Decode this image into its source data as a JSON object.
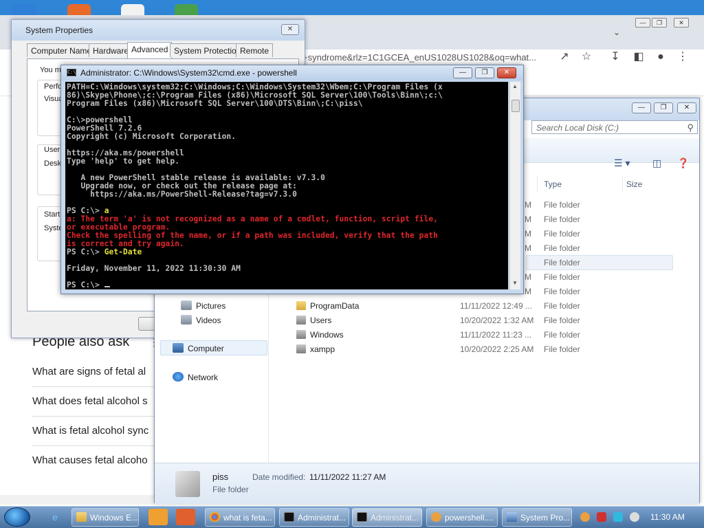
{
  "colors": {
    "console_bg": "#000000",
    "console_text": "#c0c0c0",
    "console_error": "#e0262c",
    "console_highlight": "#e6e03c",
    "taskbar": "#47719f"
  },
  "chrome": {
    "url_fragment": "+syndrome&rlz=1C1GCEA_enUS1028US1028&oq=what...",
    "people_also_ask": "People also ask",
    "questions": [
      "What are signs of fetal al",
      "What does fetal alcohol s",
      "What is fetal alcohol sync",
      "What causes fetal alcoho"
    ]
  },
  "sysprop": {
    "title": "System Properties",
    "tabs": [
      "Computer Name",
      "Hardware",
      "Advanced",
      "System Protection",
      "Remote"
    ],
    "active_tab": "Advanced",
    "fragments": [
      "You m",
      "Perfo",
      "Visua",
      "User",
      "Desk",
      "Startu",
      "Syste"
    ]
  },
  "explorer": {
    "search_placeholder": "Search Local Disk (C:)",
    "columns": [
      "Type",
      "Size"
    ],
    "nav_items": [
      "Pictures",
      "Videos",
      "Computer",
      "Network"
    ],
    "partial_rows": [
      {
        "frag": "M",
        "type": "File folder"
      },
      {
        "frag": "M",
        "type": "File folder"
      },
      {
        "frag": "M",
        "type": "File folder"
      },
      {
        "frag": "M",
        "type": "File folder"
      },
      {
        "frag": "",
        "type": "File folder"
      },
      {
        "frag": "M",
        "type": "File folder"
      },
      {
        "frag": "M",
        "type": "File folder"
      }
    ],
    "rows": [
      {
        "name": "ProgramData",
        "date": "11/11/2022 12:49 ...",
        "type": "File folder"
      },
      {
        "name": "Users",
        "date": "10/20/2022 1:32 AM",
        "type": "File folder"
      },
      {
        "name": "Windows",
        "date": "11/11/2022 11:23 ...",
        "type": "File folder"
      },
      {
        "name": "xampp",
        "date": "10/20/2022 2:25 AM",
        "type": "File folder"
      }
    ],
    "details": {
      "name": "piss",
      "label": "Date modified:",
      "date": "11/11/2022 11:27 AM",
      "type": "File folder"
    }
  },
  "cmd": {
    "title": "Administrator: C:\\Windows\\System32\\cmd.exe - powershell",
    "lines": {
      "l1": "PATH=C:\\Windows\\system32;C:\\Windows;C:\\Windows\\System32\\Wbem;C:\\Program Files (x",
      "l2": "86)\\Skype\\Phone\\;c:\\Program Files (x86)\\Microsoft SQL Server\\100\\Tools\\Binn\\;c:\\",
      "l3": "Program Files (x86)\\Microsoft SQL Server\\100\\DTS\\Binn\\;C:\\piss\\",
      "l4": "",
      "l5": "C:\\>powershell",
      "l6": "PowerShell 7.2.6",
      "l7": "Copyright (c) Microsoft Corporation.",
      "l8": "",
      "l9": "https://aka.ms/powershell",
      "l10": "Type 'help' to get help.",
      "l11": "",
      "l12": "   A new PowerShell stable release is available: v7.3.0",
      "l13": "   Upgrade now, or check out the release page at:",
      "l14": "     https://aka.ms/PowerShell-Release?tag=v7.3.0",
      "l15": "",
      "l16_prompt": "PS C:\\> ",
      "l16_cmd": "a",
      "l17": "a: The term 'a' is not recognized as a name of a cmdlet, function, script file,",
      "l18": "or executable program.",
      "l19": "Check the spelling of the name, or if a path was included, verify that the path",
      "l20": "is correct and try again.",
      "l21_prompt": "PS C:\\> ",
      "l21_cmd": "Get-Date",
      "l22": "",
      "l23": "Friday, November 11, 2022 11:30:30 AM",
      "l24": "",
      "l25_prompt": "PS C:\\> "
    }
  },
  "taskbar": {
    "buttons": [
      "Windows E...",
      "what is feta...",
      "Administrat...",
      "Administrat...",
      "powershell....",
      "System Pro..."
    ],
    "clock": "11:30 AM"
  }
}
